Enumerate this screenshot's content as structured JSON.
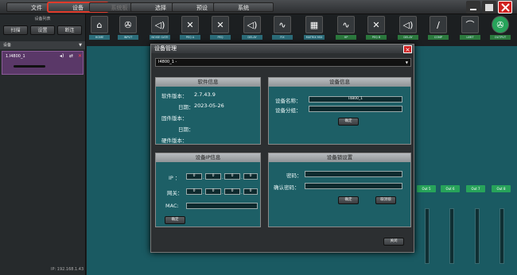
{
  "menu": [
    "文件",
    "设备",
    "系统板",
    "选择",
    "预设",
    "系统"
  ],
  "left_panel": {
    "title": "设备列表",
    "buttons": [
      "扫描",
      "设置",
      "断连"
    ],
    "device_header": "设备",
    "device_name": "1.I4800_1",
    "ip_label": "IP: 192.168.1.43"
  },
  "modules": [
    {
      "icon": "⌂",
      "label": "HOME"
    },
    {
      "icon": "✇",
      "label": "INPUT"
    },
    {
      "icon": "◁)",
      "label": "NOISE GATE"
    },
    {
      "icon": "✕",
      "label": "PEQ A"
    },
    {
      "icon": "✕",
      "label": "PEQ"
    },
    {
      "icon": "◁)",
      "label": "DELAY"
    },
    {
      "icon": "∿",
      "label": "FIX"
    },
    {
      "icon": "▦",
      "label": "MATRIX MIX"
    },
    {
      "icon": "∿",
      "label": "HP"
    },
    {
      "icon": "✕",
      "label": "PEQ B"
    },
    {
      "icon": "◁)",
      "label": "DELAY"
    },
    {
      "icon": "∕",
      "label": "COMP"
    },
    {
      "icon": "⌒",
      "label": "LIMIT"
    },
    {
      "icon": "✇",
      "label": "OUTPUT"
    }
  ],
  "outputs": [
    "Out 5",
    "Out 6",
    "Out 7",
    "Out 8"
  ],
  "dialog": {
    "title": "设备管理",
    "device_select": "I4800_1 -",
    "software": {
      "header": "软件信息",
      "version_label": "软件版本：",
      "version_value": "2.7.43.9",
      "date_label": "日期：",
      "date_value": "2023-05-26",
      "fw_version_label": "固件版本：",
      "fw_date_label": "日期：",
      "hw_version_label": "硬件版本："
    },
    "device_info": {
      "header": "设备信息",
      "name_label": "设备名称：",
      "name_value": "I4800_1",
      "group_label": "设备分组：",
      "confirm": "确定"
    },
    "ip_info": {
      "header": "设备IP信息",
      "ip_label": "IP ：",
      "ip_values": [
        "0",
        "0",
        "0",
        "0"
      ],
      "gateway_label": "网关：",
      "gateway_values": [
        "0",
        "0",
        "0",
        "0"
      ],
      "mac_label": "MAC:",
      "confirm": "确定"
    },
    "lock": {
      "header": "设备锁设置",
      "password_label": "密码：",
      "confirm_password_label": "确认密码：",
      "confirm": "确定",
      "cancel_lock": "取消锁"
    },
    "close_button": "关闭"
  }
}
